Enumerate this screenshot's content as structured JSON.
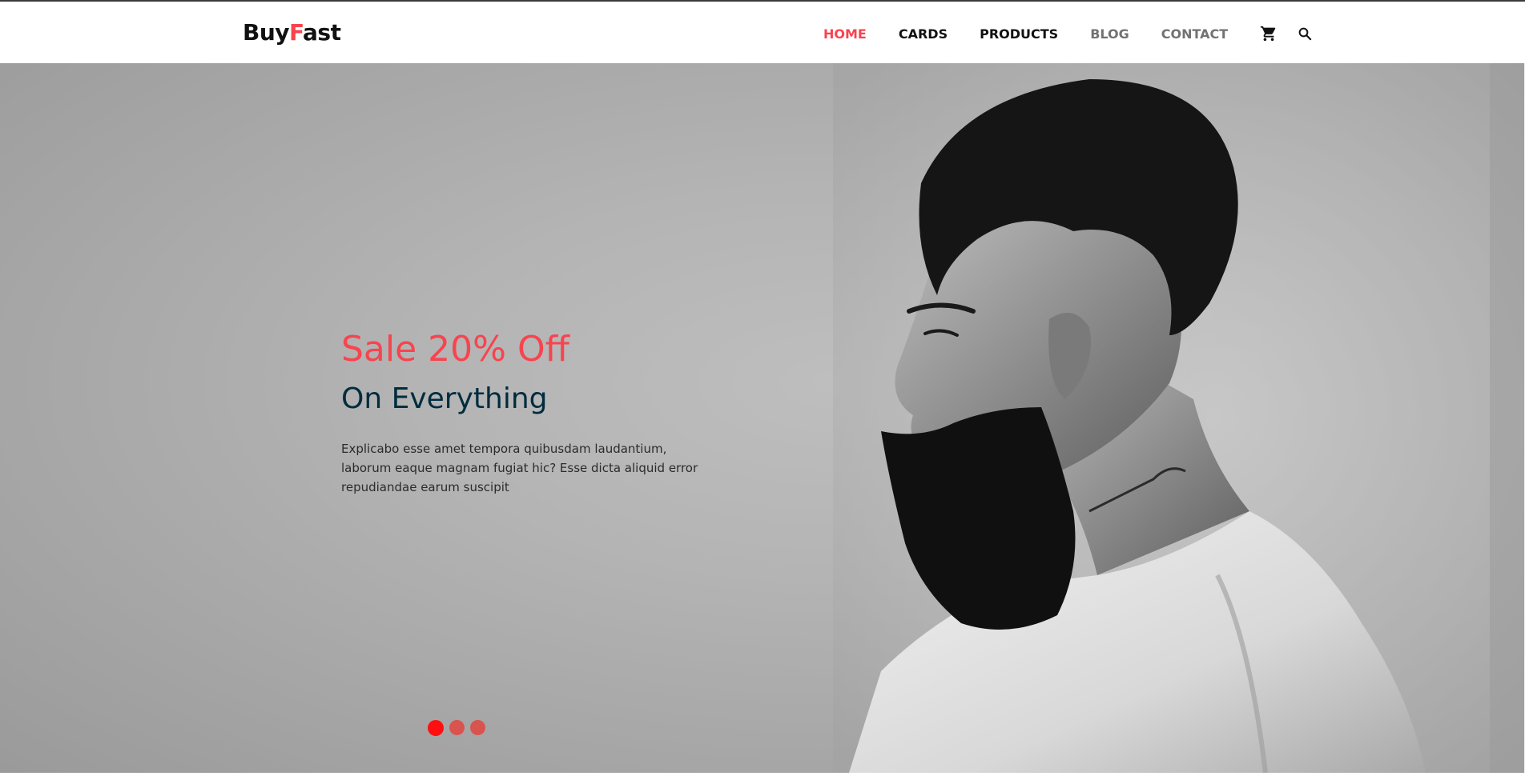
{
  "header": {
    "logo": {
      "part1": "Buy",
      "part2": "F",
      "part3": "ast"
    },
    "nav": [
      {
        "label": "HOME"
      },
      {
        "label": "CARDS"
      },
      {
        "label": "PRODUCTS"
      },
      {
        "label": "BLOG"
      },
      {
        "label": "CONTACT"
      }
    ],
    "icons": {
      "cart": "cart-icon",
      "search": "search-icon"
    }
  },
  "hero": {
    "title": "Sale 20% Off",
    "subtitle": "On Everything",
    "description": "Explicabo esse amet tempora quibusdam laudantium, laborum eaque magnam fugiat hic? Esse dicta aliquid error repudiandae earum suscipit",
    "carousel": {
      "slides": 3,
      "active_index": 0
    }
  },
  "colors": {
    "accent": "#f7444e",
    "heading_dark": "#002c3e",
    "dot_active": "#ff1010",
    "dot_inactive": "#d9534f"
  }
}
